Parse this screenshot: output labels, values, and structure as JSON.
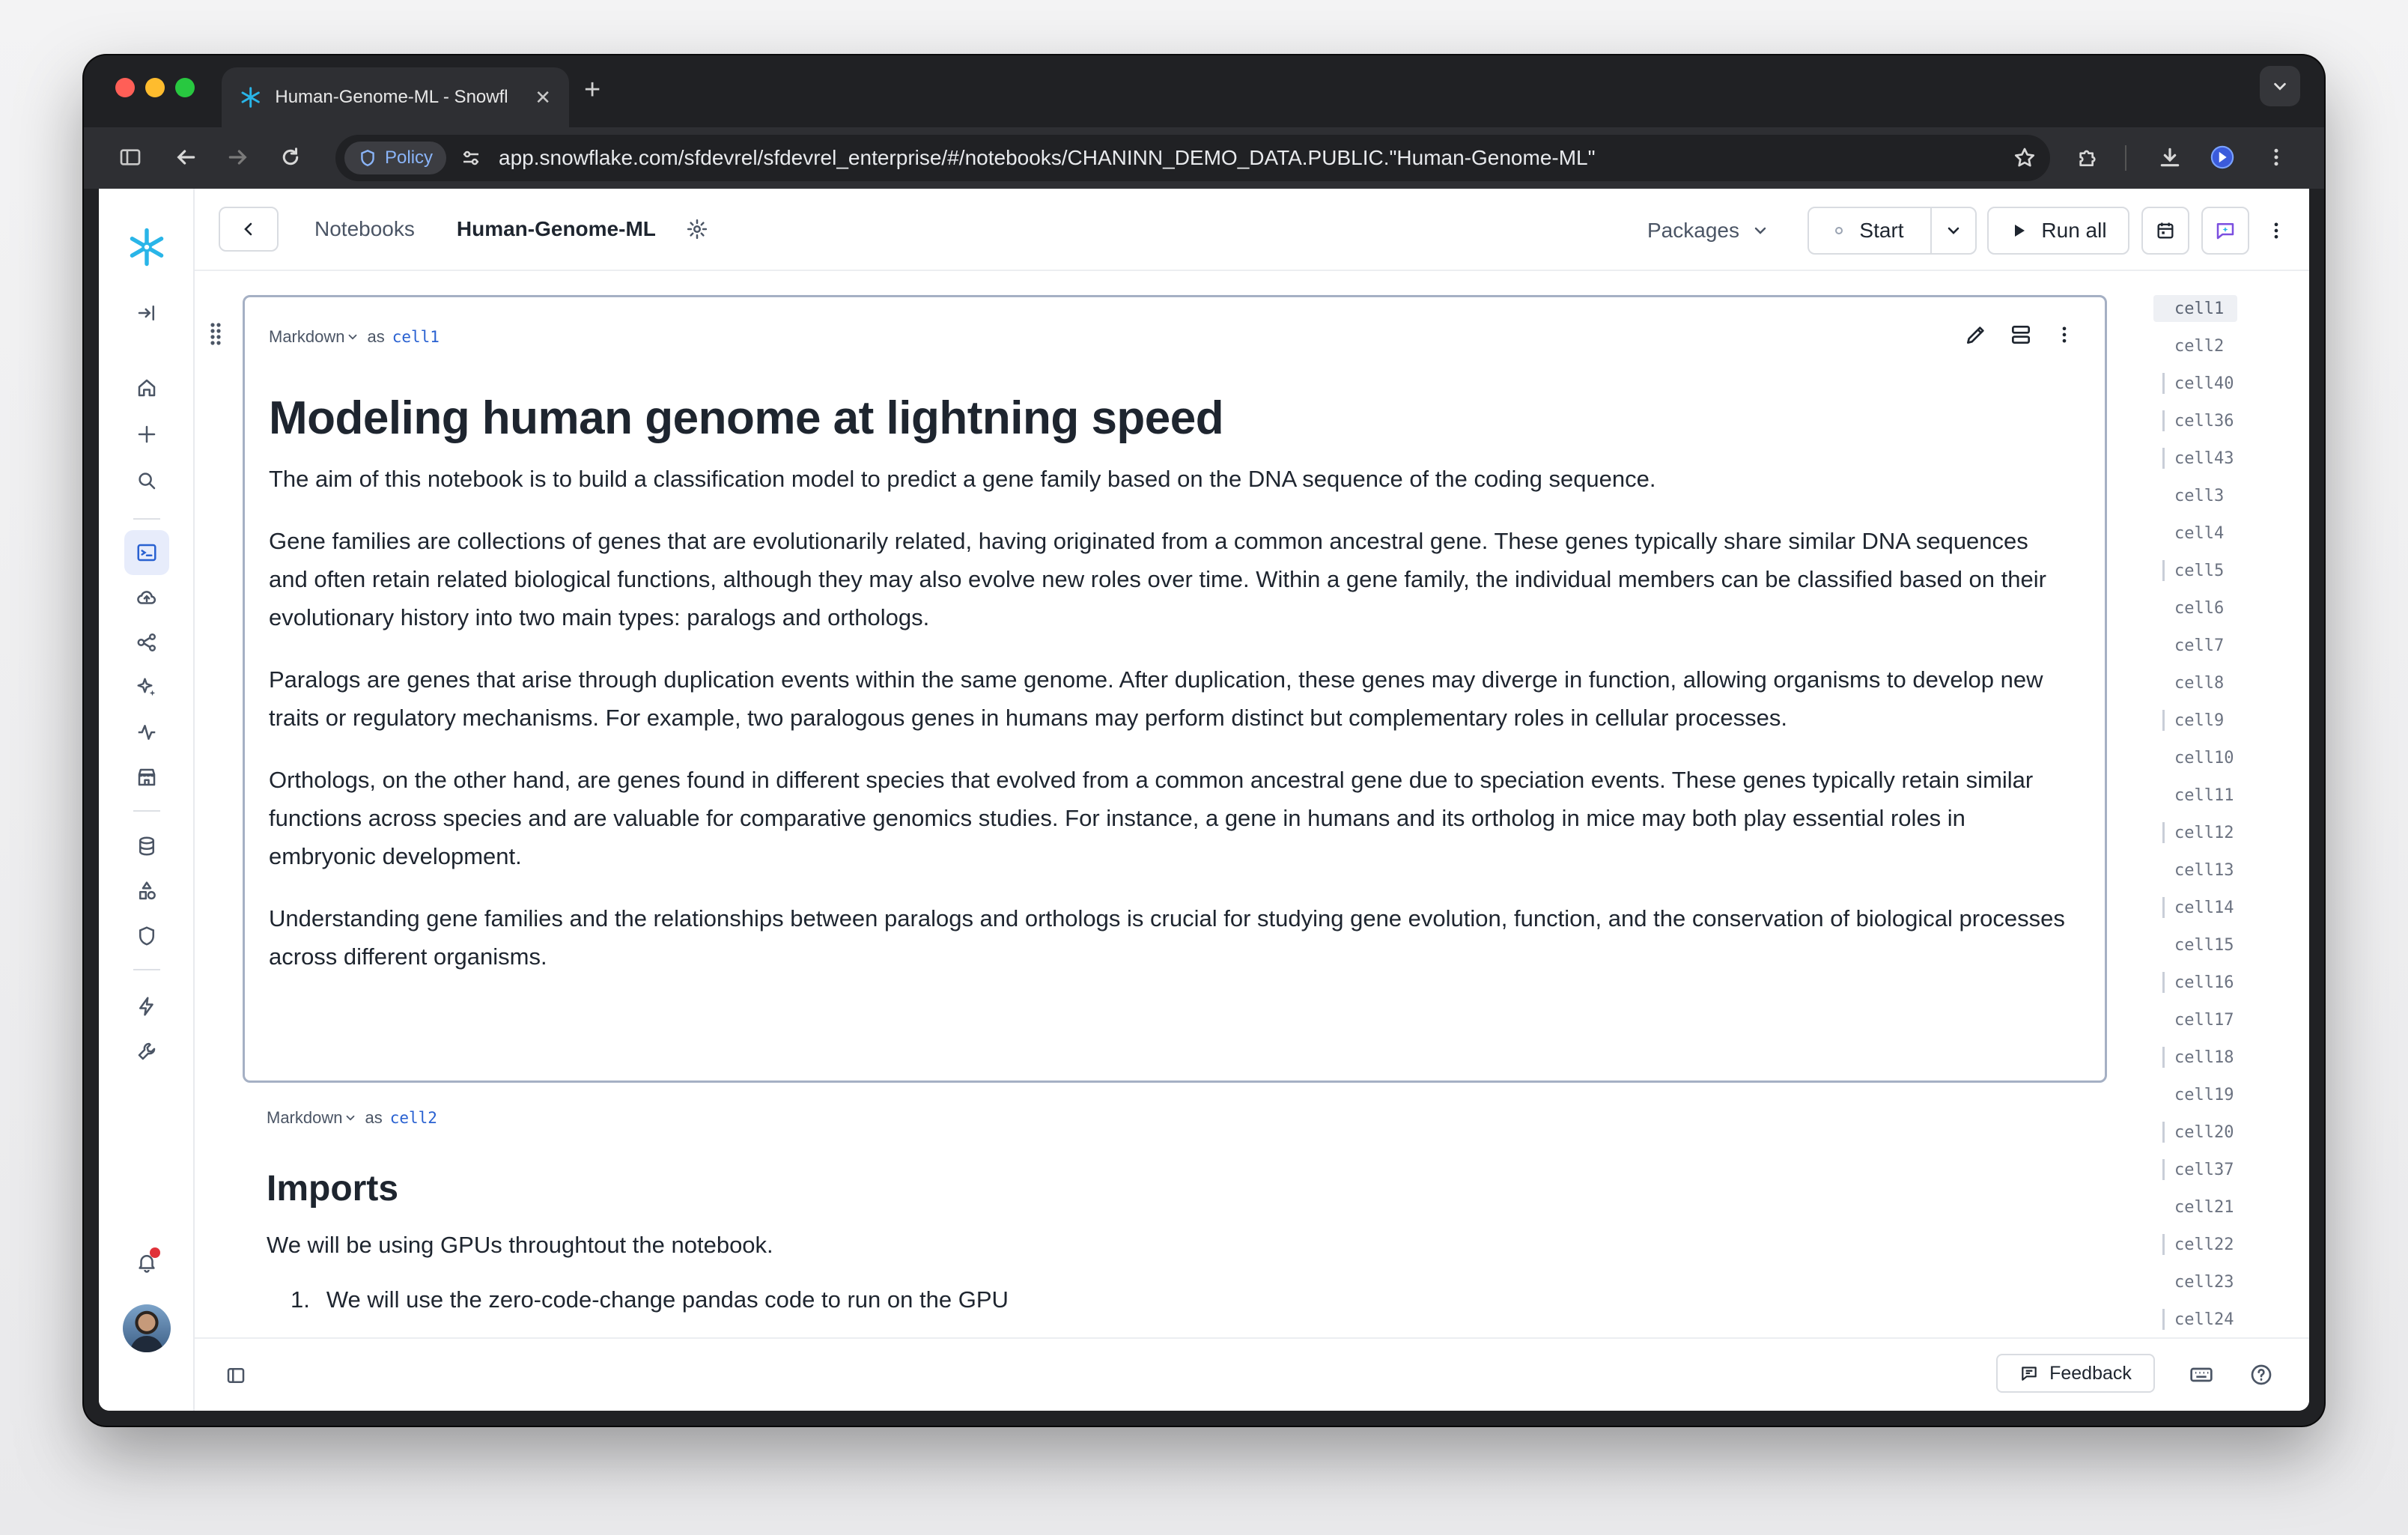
{
  "browser": {
    "tab_title": "Human-Genome-ML - Snowfl",
    "policy_label": "Policy",
    "url": "app.snowflake.com/sfdevrel/sfdevrel_enterprise/#/notebooks/CHANINN_DEMO_DATA.PUBLIC.\"Human-Genome-ML\""
  },
  "header": {
    "breadcrumb": "Notebooks",
    "title": "Human-Genome-ML",
    "packages_label": "Packages",
    "start_label": "Start",
    "run_all_label": "Run all"
  },
  "cell1": {
    "type_label": "Markdown",
    "as_label": "as",
    "name": "cell1",
    "heading": "Modeling human genome at lightning speed",
    "paragraphs": [
      "The aim of this notebook is to build a classification model to predict a gene family based on the DNA sequence of the coding sequence.",
      "Gene families are collections of genes that are evolutionarily related, having originated from a common ancestral gene. These genes typically share similar DNA sequences and often retain related biological functions, although they may also evolve new roles over time. Within a gene family, the individual members can be classified based on their evolutionary history into two main types: paralogs and orthologs.",
      "Paralogs are genes that arise through duplication events within the same genome. After duplication, these genes may diverge in function, allowing organisms to develop new traits or regulatory mechanisms. For example, two paralogous genes in humans may perform distinct but complementary roles in cellular processes.",
      "Orthologs, on the other hand, are genes found in different species that evolved from a common ancestral gene due to speciation events. These genes typically retain similar functions across species and are valuable for comparative genomics studies. For instance, a gene in humans and its ortholog in mice may both play essential roles in embryonic development.",
      "Understanding gene families and the relationships between paralogs and orthologs is crucial for studying gene evolution, function, and the conservation of biological processes across different organisms."
    ]
  },
  "cell2": {
    "type_label": "Markdown",
    "as_label": "as",
    "name": "cell2",
    "heading": "Imports",
    "paragraph": "We will be using GPUs throughtout the notebook.",
    "list_item_number": "1.",
    "list_item_partial": "We will use the zero-code-change pandas code to run on the GPU"
  },
  "outline": [
    "cell1",
    "cell2",
    "cell40",
    "cell36",
    "cell43",
    "cell3",
    "cell4",
    "cell5",
    "cell6",
    "cell7",
    "cell8",
    "cell9",
    "cell10",
    "cell11",
    "cell12",
    "cell13",
    "cell14",
    "cell15",
    "cell16",
    "cell17",
    "cell18",
    "cell19",
    "cell20",
    "cell37",
    "cell21",
    "cell22",
    "cell23",
    "cell24"
  ],
  "footer": {
    "feedback_label": "Feedback"
  },
  "colors": {
    "brand": "#29b5e8",
    "accent": "#2961d1",
    "notification": "#e0323a"
  }
}
